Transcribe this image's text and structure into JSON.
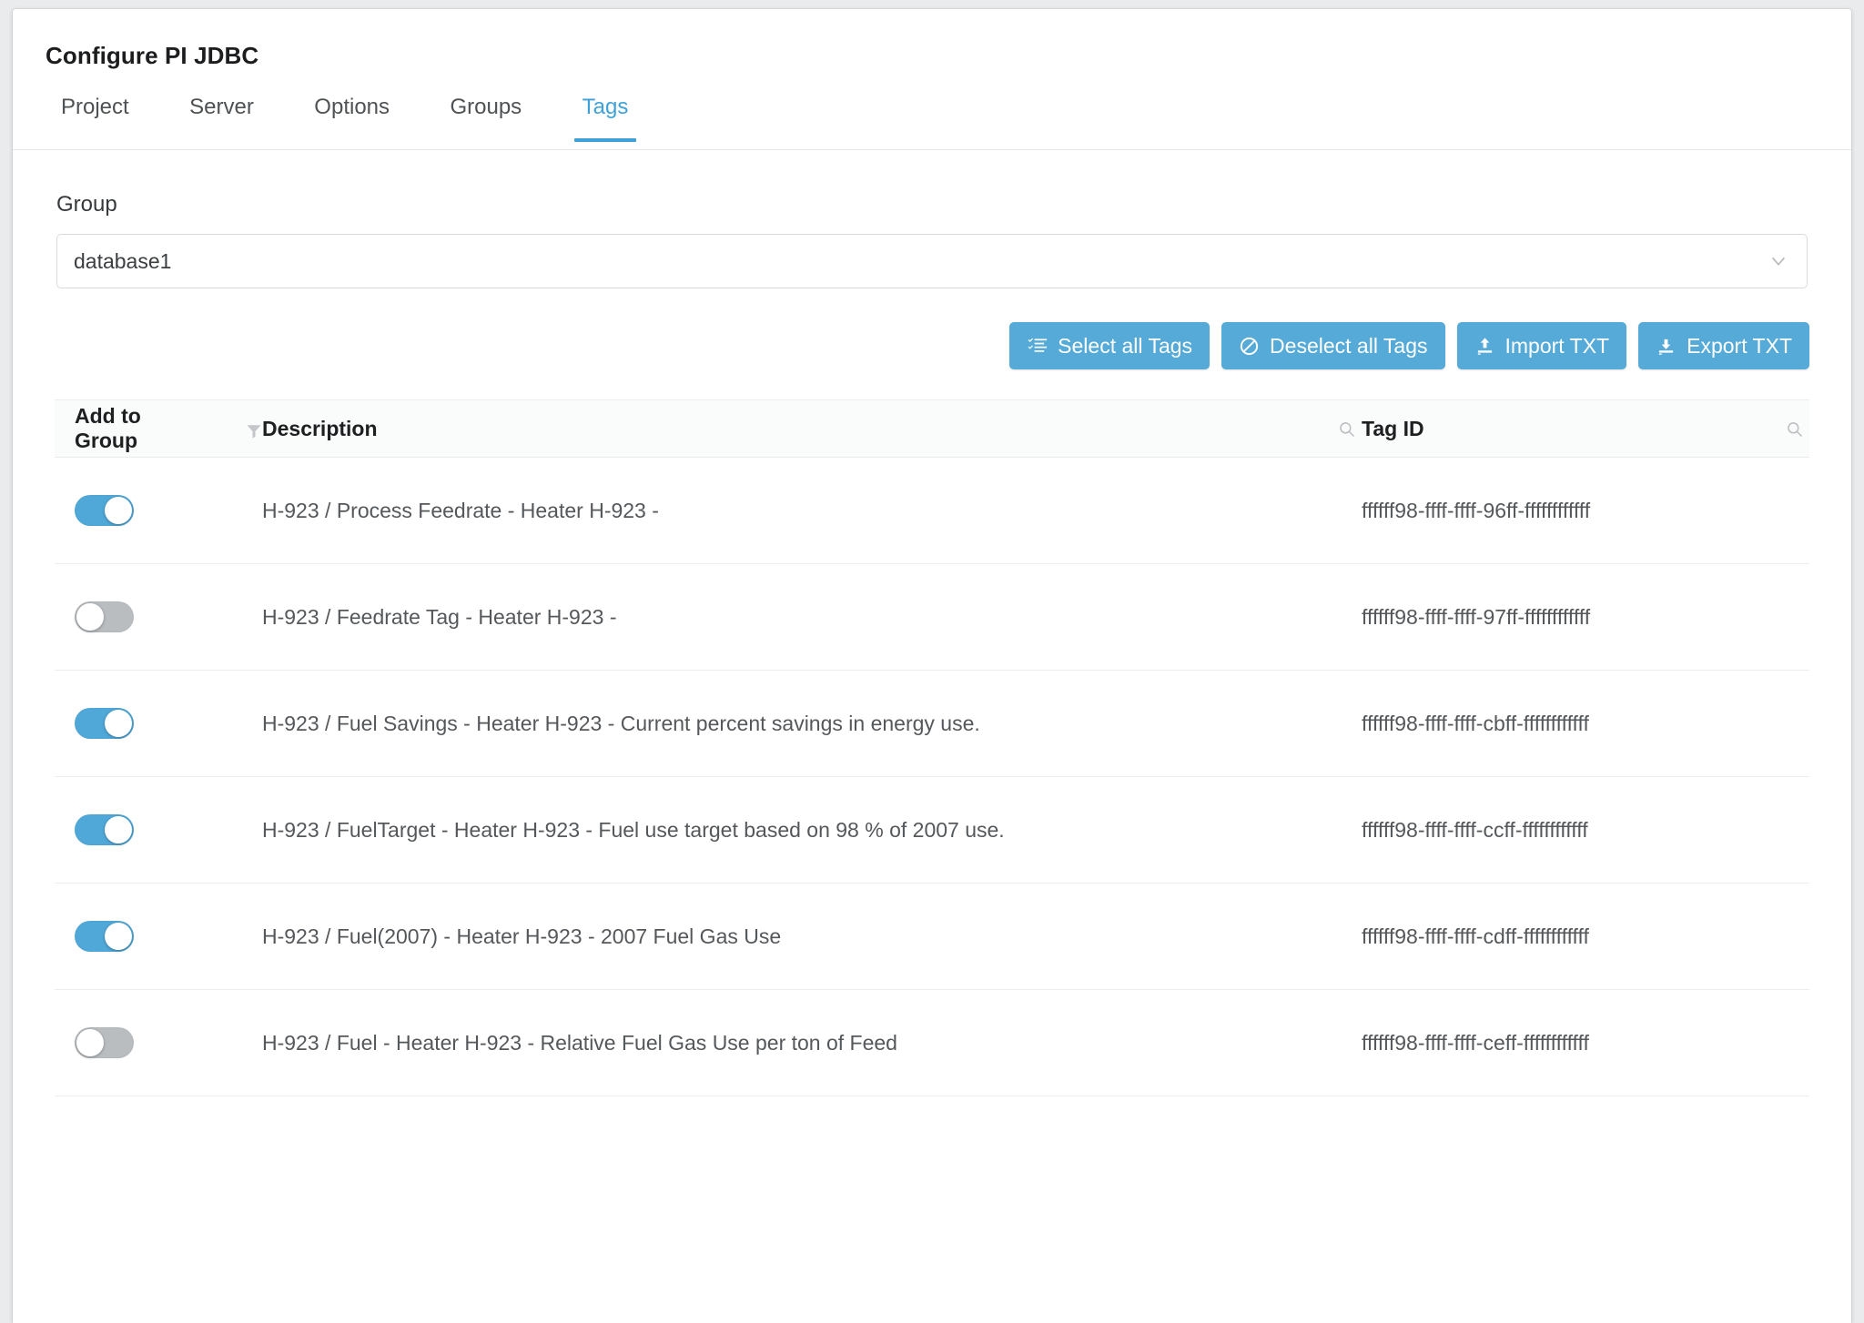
{
  "dialog": {
    "title": "Configure PI JDBC"
  },
  "tabs": [
    {
      "label": "Project",
      "active": false
    },
    {
      "label": "Server",
      "active": false
    },
    {
      "label": "Options",
      "active": false
    },
    {
      "label": "Groups",
      "active": false
    },
    {
      "label": "Tags",
      "active": true
    }
  ],
  "group_field": {
    "label": "Group",
    "value": "database1",
    "chevron_icon": "chevron-down-icon"
  },
  "toolbar": {
    "select_all_label": "Select all Tags",
    "deselect_all_label": "Deselect all Tags",
    "import_label": "Import TXT",
    "export_label": "Export TXT",
    "select_all_icon": "list-check-icon",
    "deselect_all_icon": "ban-icon",
    "import_icon": "upload-icon",
    "export_icon": "download-icon",
    "button_color": "#55aad7"
  },
  "table": {
    "headers": {
      "add_to_group": "Add to Group",
      "description": "Description",
      "tag_id": "Tag ID"
    },
    "filter_icon": "funnel-icon",
    "search_icon": "search-icon",
    "rows": [
      {
        "enabled": true,
        "description": "H-923 / Process Feedrate - Heater H-923 -",
        "tag_id": "ffffff98-ffff-ffff-96ff-ffffffffffff"
      },
      {
        "enabled": false,
        "description": "H-923 / Feedrate Tag - Heater H-923 -",
        "tag_id": "ffffff98-ffff-ffff-97ff-ffffffffffff"
      },
      {
        "enabled": true,
        "description": "H-923 / Fuel Savings - Heater H-923 - Current percent savings in energy use.",
        "tag_id": "ffffff98-ffff-ffff-cbff-ffffffffffff"
      },
      {
        "enabled": true,
        "description": "H-923 / FuelTarget - Heater H-923 - Fuel use target based on 98 % of 2007 use.",
        "tag_id": "ffffff98-ffff-ffff-ccff-ffffffffffff"
      },
      {
        "enabled": true,
        "description": "H-923 / Fuel(2007) - Heater H-923 - 2007 Fuel Gas Use",
        "tag_id": "ffffff98-ffff-ffff-cdff-ffffffffffff"
      },
      {
        "enabled": false,
        "description": "H-923 / Fuel - Heater H-923 - Relative Fuel Gas Use per ton of Feed",
        "tag_id": "ffffff98-ffff-ffff-ceff-ffffffffffff"
      }
    ]
  },
  "theme": {
    "accent": "#3ea2d8",
    "toggle_on": "#50a8d8",
    "toggle_off": "#b9bdc0"
  }
}
